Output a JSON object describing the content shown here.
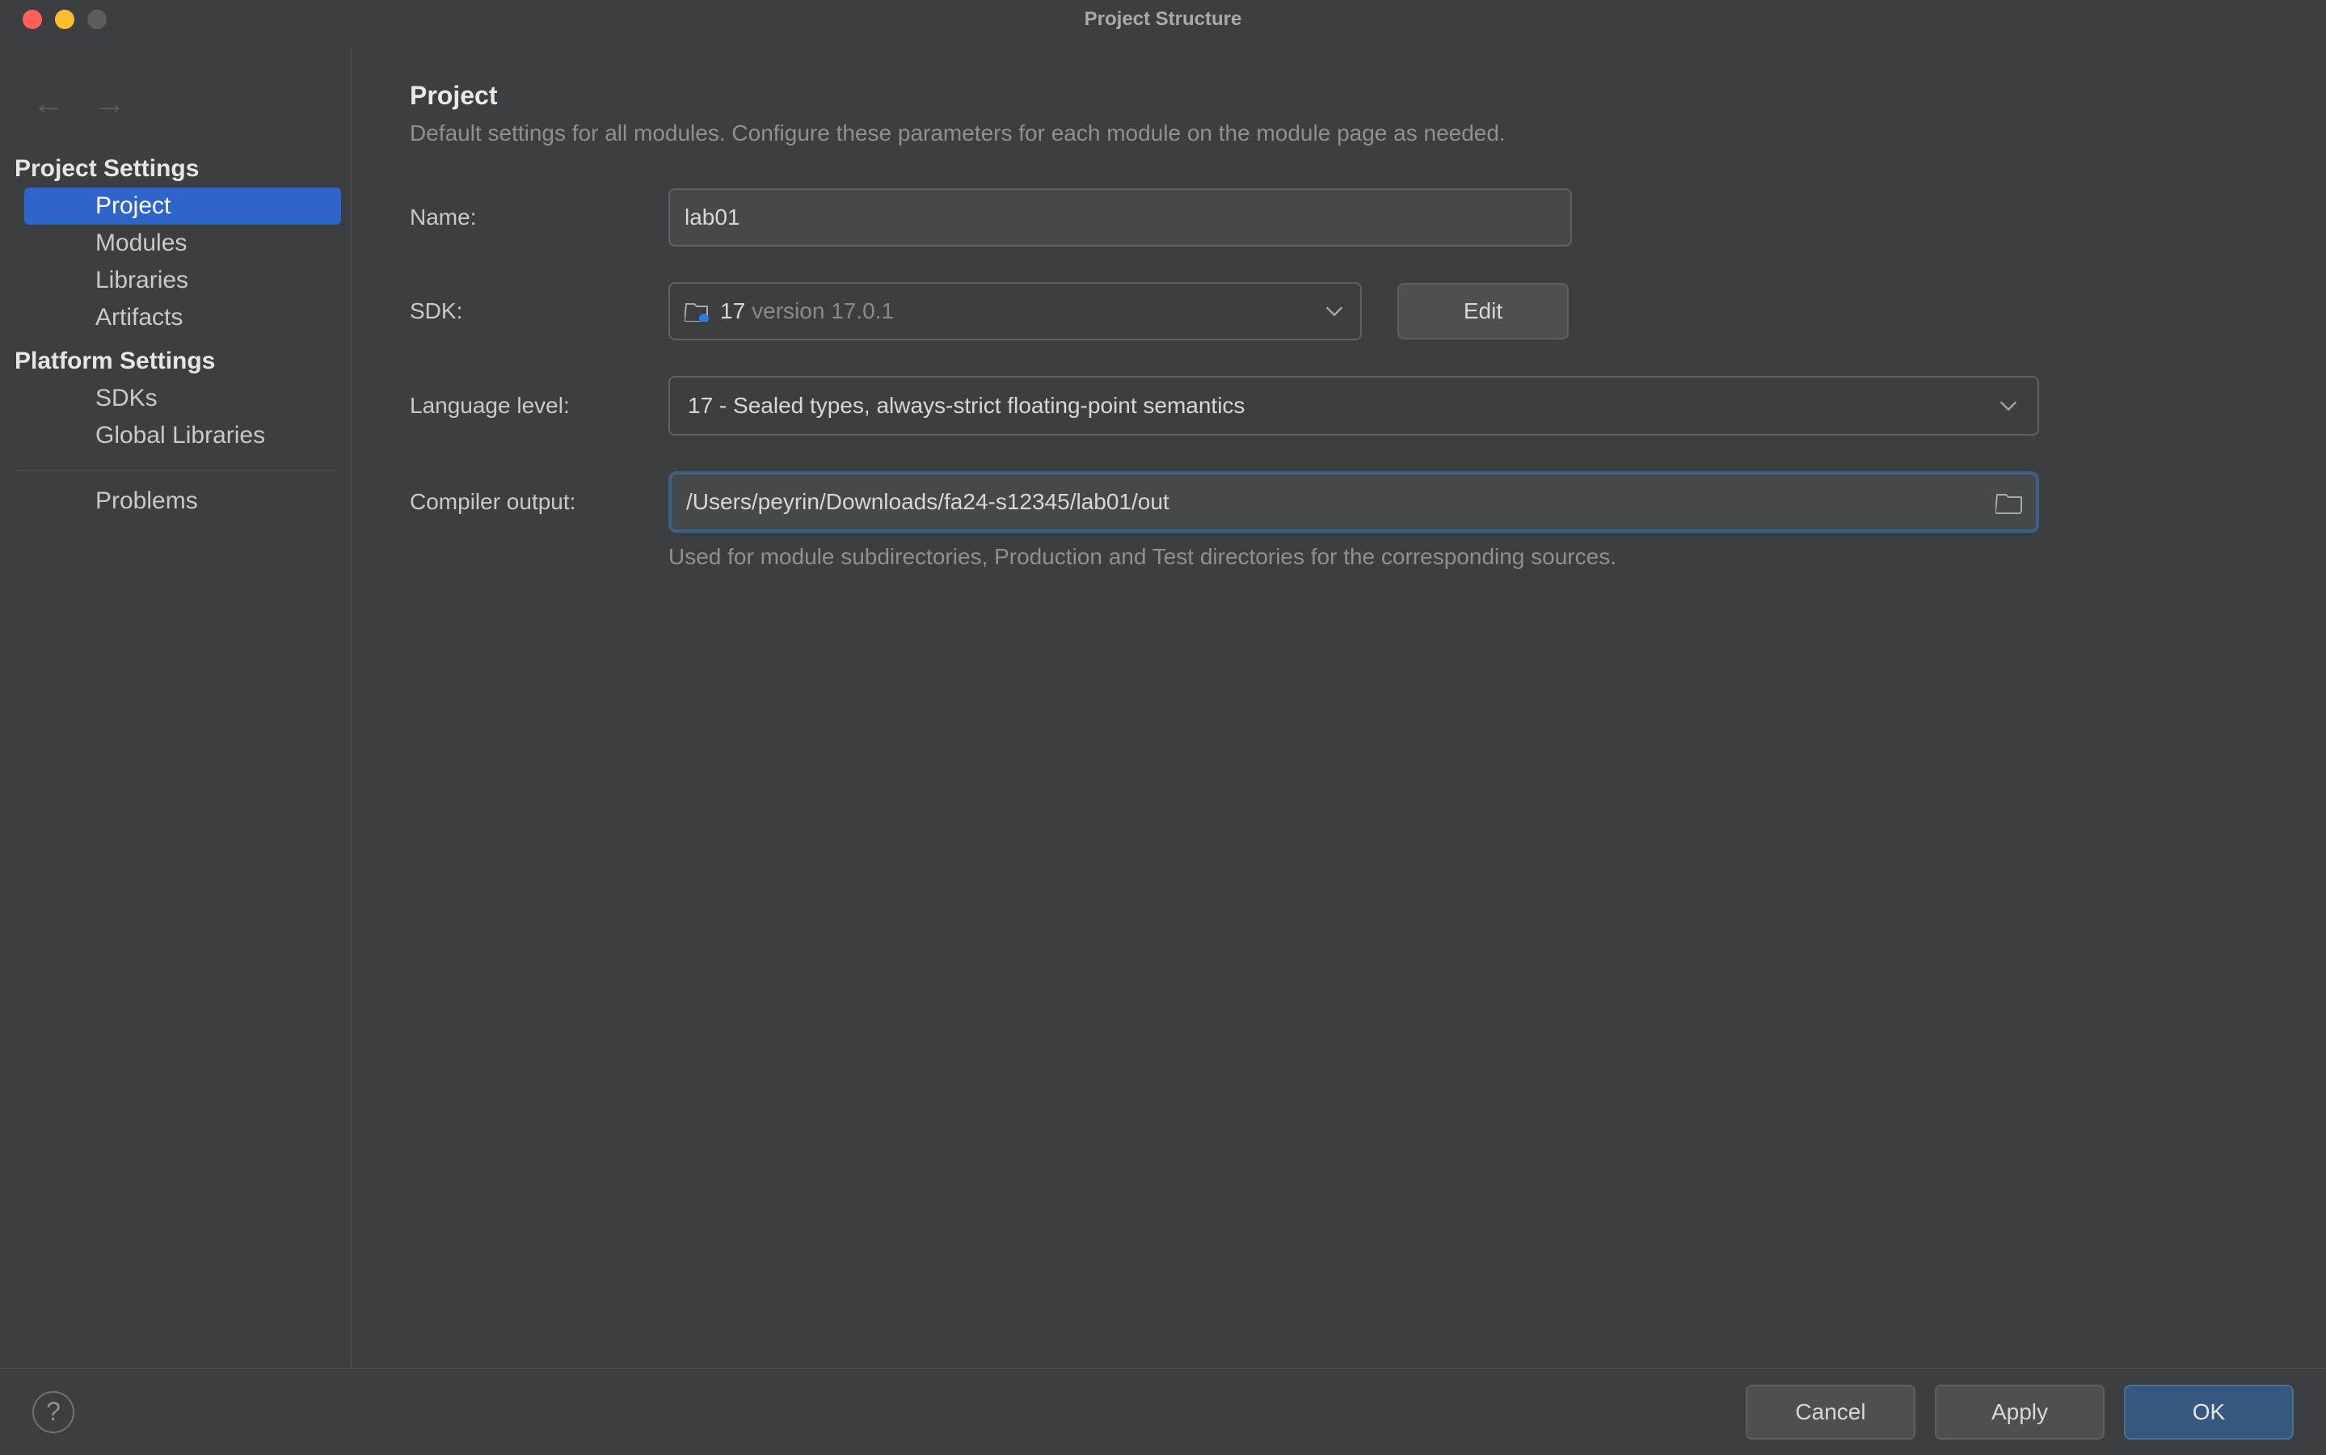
{
  "window": {
    "title": "Project Structure"
  },
  "sidebar": {
    "sections": [
      {
        "title": "Project Settings",
        "items": [
          "Project",
          "Modules",
          "Libraries",
          "Artifacts"
        ],
        "selected_index": 0
      },
      {
        "title": "Platform Settings",
        "items": [
          "SDKs",
          "Global Libraries"
        ]
      }
    ],
    "problems_label": "Problems"
  },
  "content": {
    "page_title": "Project",
    "page_sub": "Default settings for all modules. Configure these parameters for each module on the module page as needed.",
    "name": {
      "label": "Name:",
      "value": "lab01"
    },
    "sdk": {
      "label": "SDK:",
      "selected_name": "17",
      "selected_detail": "version 17.0.1",
      "edit_label": "Edit"
    },
    "language_level": {
      "label": "Language level:",
      "value": "17 - Sealed types, always-strict floating-point semantics"
    },
    "compiler_output": {
      "label": "Compiler output:",
      "value": "/Users/peyrin/Downloads/fa24-s12345/lab01/out",
      "help": "Used for module subdirectories, Production and Test directories for the corresponding sources."
    }
  },
  "footer": {
    "cancel": "Cancel",
    "apply": "Apply",
    "ok": "OK"
  }
}
